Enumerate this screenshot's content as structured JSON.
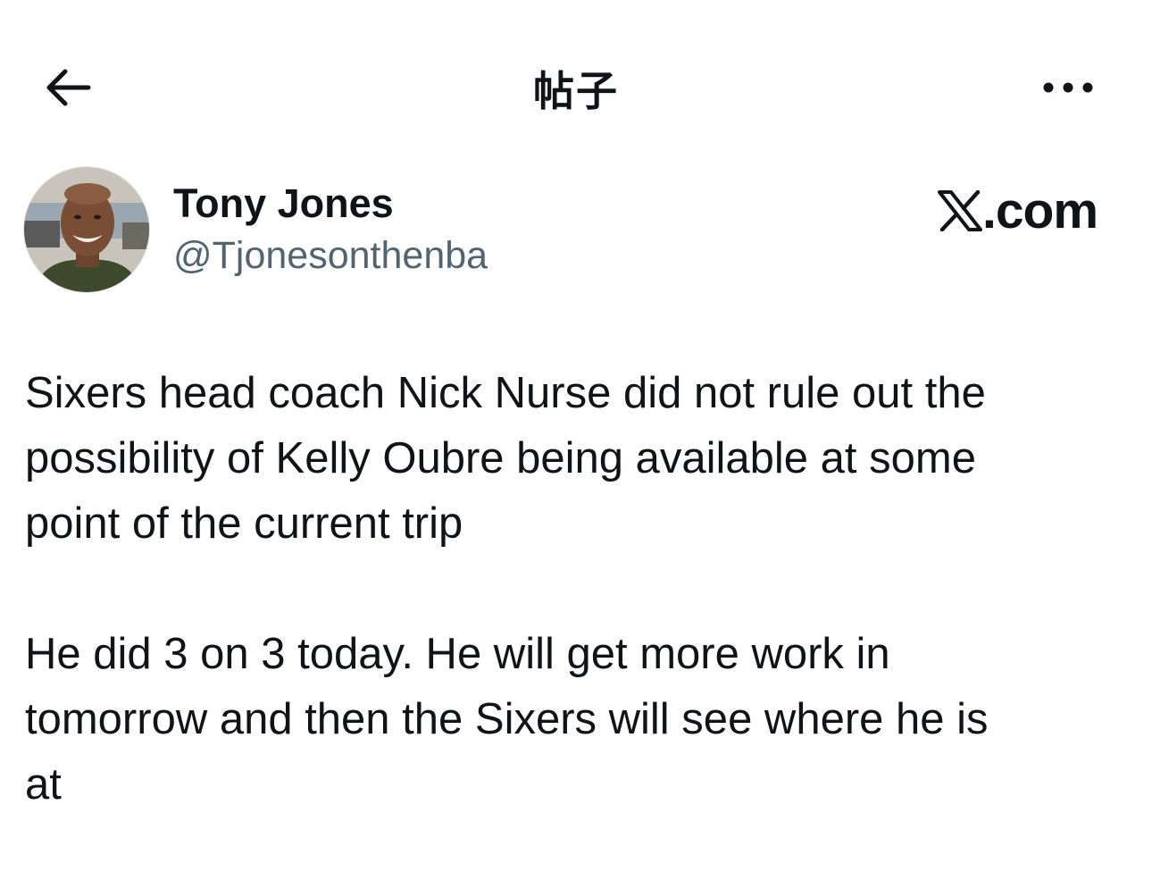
{
  "header": {
    "title": "帖子",
    "back_icon": "arrow-left-icon",
    "more_icon": "more-horizontal-icon"
  },
  "author": {
    "display_name": "Tony Jones",
    "handle": "@Tjonesonthenba",
    "avatar_icon": "avatar-photo"
  },
  "brand": {
    "suffix": ".com",
    "logo_icon": "x-logo-icon"
  },
  "tweet": {
    "paragraphs": [
      "Sixers head coach Nick Nurse did not rule out the\npossibility of Kelly Oubre being available at some\npoint of the current trip",
      "He did 3 on 3 today. He will get more work in\ntomorrow and then the Sixers will see where he is\nat"
    ]
  },
  "colors": {
    "text_primary": "#0f1419",
    "text_secondary": "#536471",
    "background": "#ffffff"
  }
}
